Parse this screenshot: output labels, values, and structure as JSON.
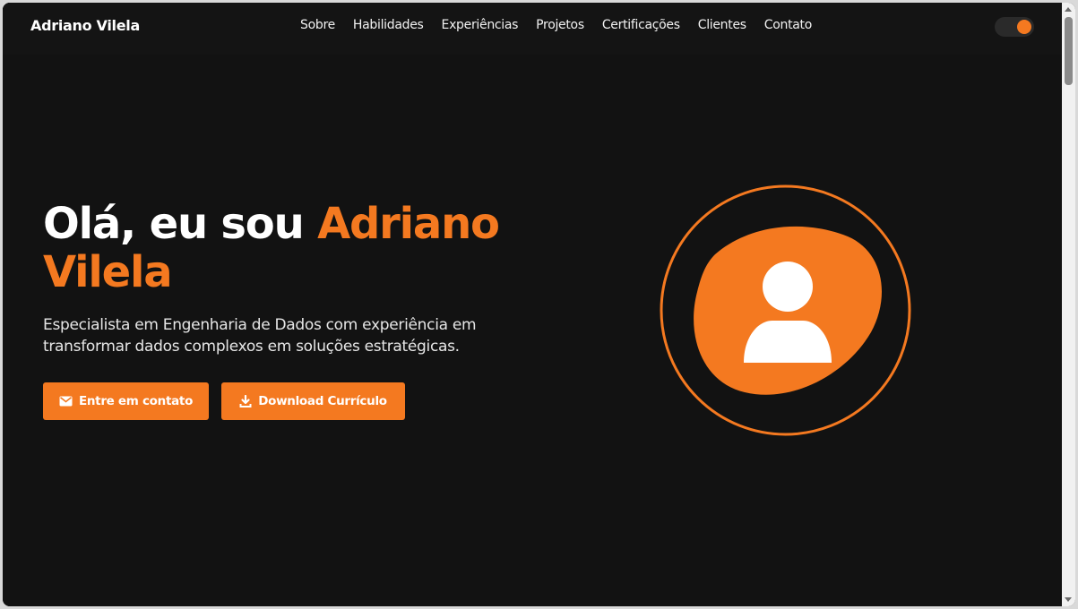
{
  "nav": {
    "brand": "Adriano Vilela",
    "links": [
      "Sobre",
      "Habilidades",
      "Experiências",
      "Projetos",
      "Certificações",
      "Clientes",
      "Contato"
    ],
    "theme_toggle_icon": "theme-toggle"
  },
  "hero": {
    "greeting": "Olá, eu sou ",
    "name": "Adriano Vilela",
    "subtitle": "Especialista em Engenharia de Dados com experiência em transformar dados complexos em soluções estratégicas.",
    "buttons": {
      "contact": "Entre em contato",
      "contact_icon": "envelope-icon",
      "cv": "Download Currículo",
      "cv_icon": "download-icon"
    },
    "avatar_icon": "user-silhouette-icon"
  },
  "colors": {
    "accent": "#f47920",
    "background": "#121212",
    "nav_background": "#141414",
    "text": "#ffffff"
  }
}
